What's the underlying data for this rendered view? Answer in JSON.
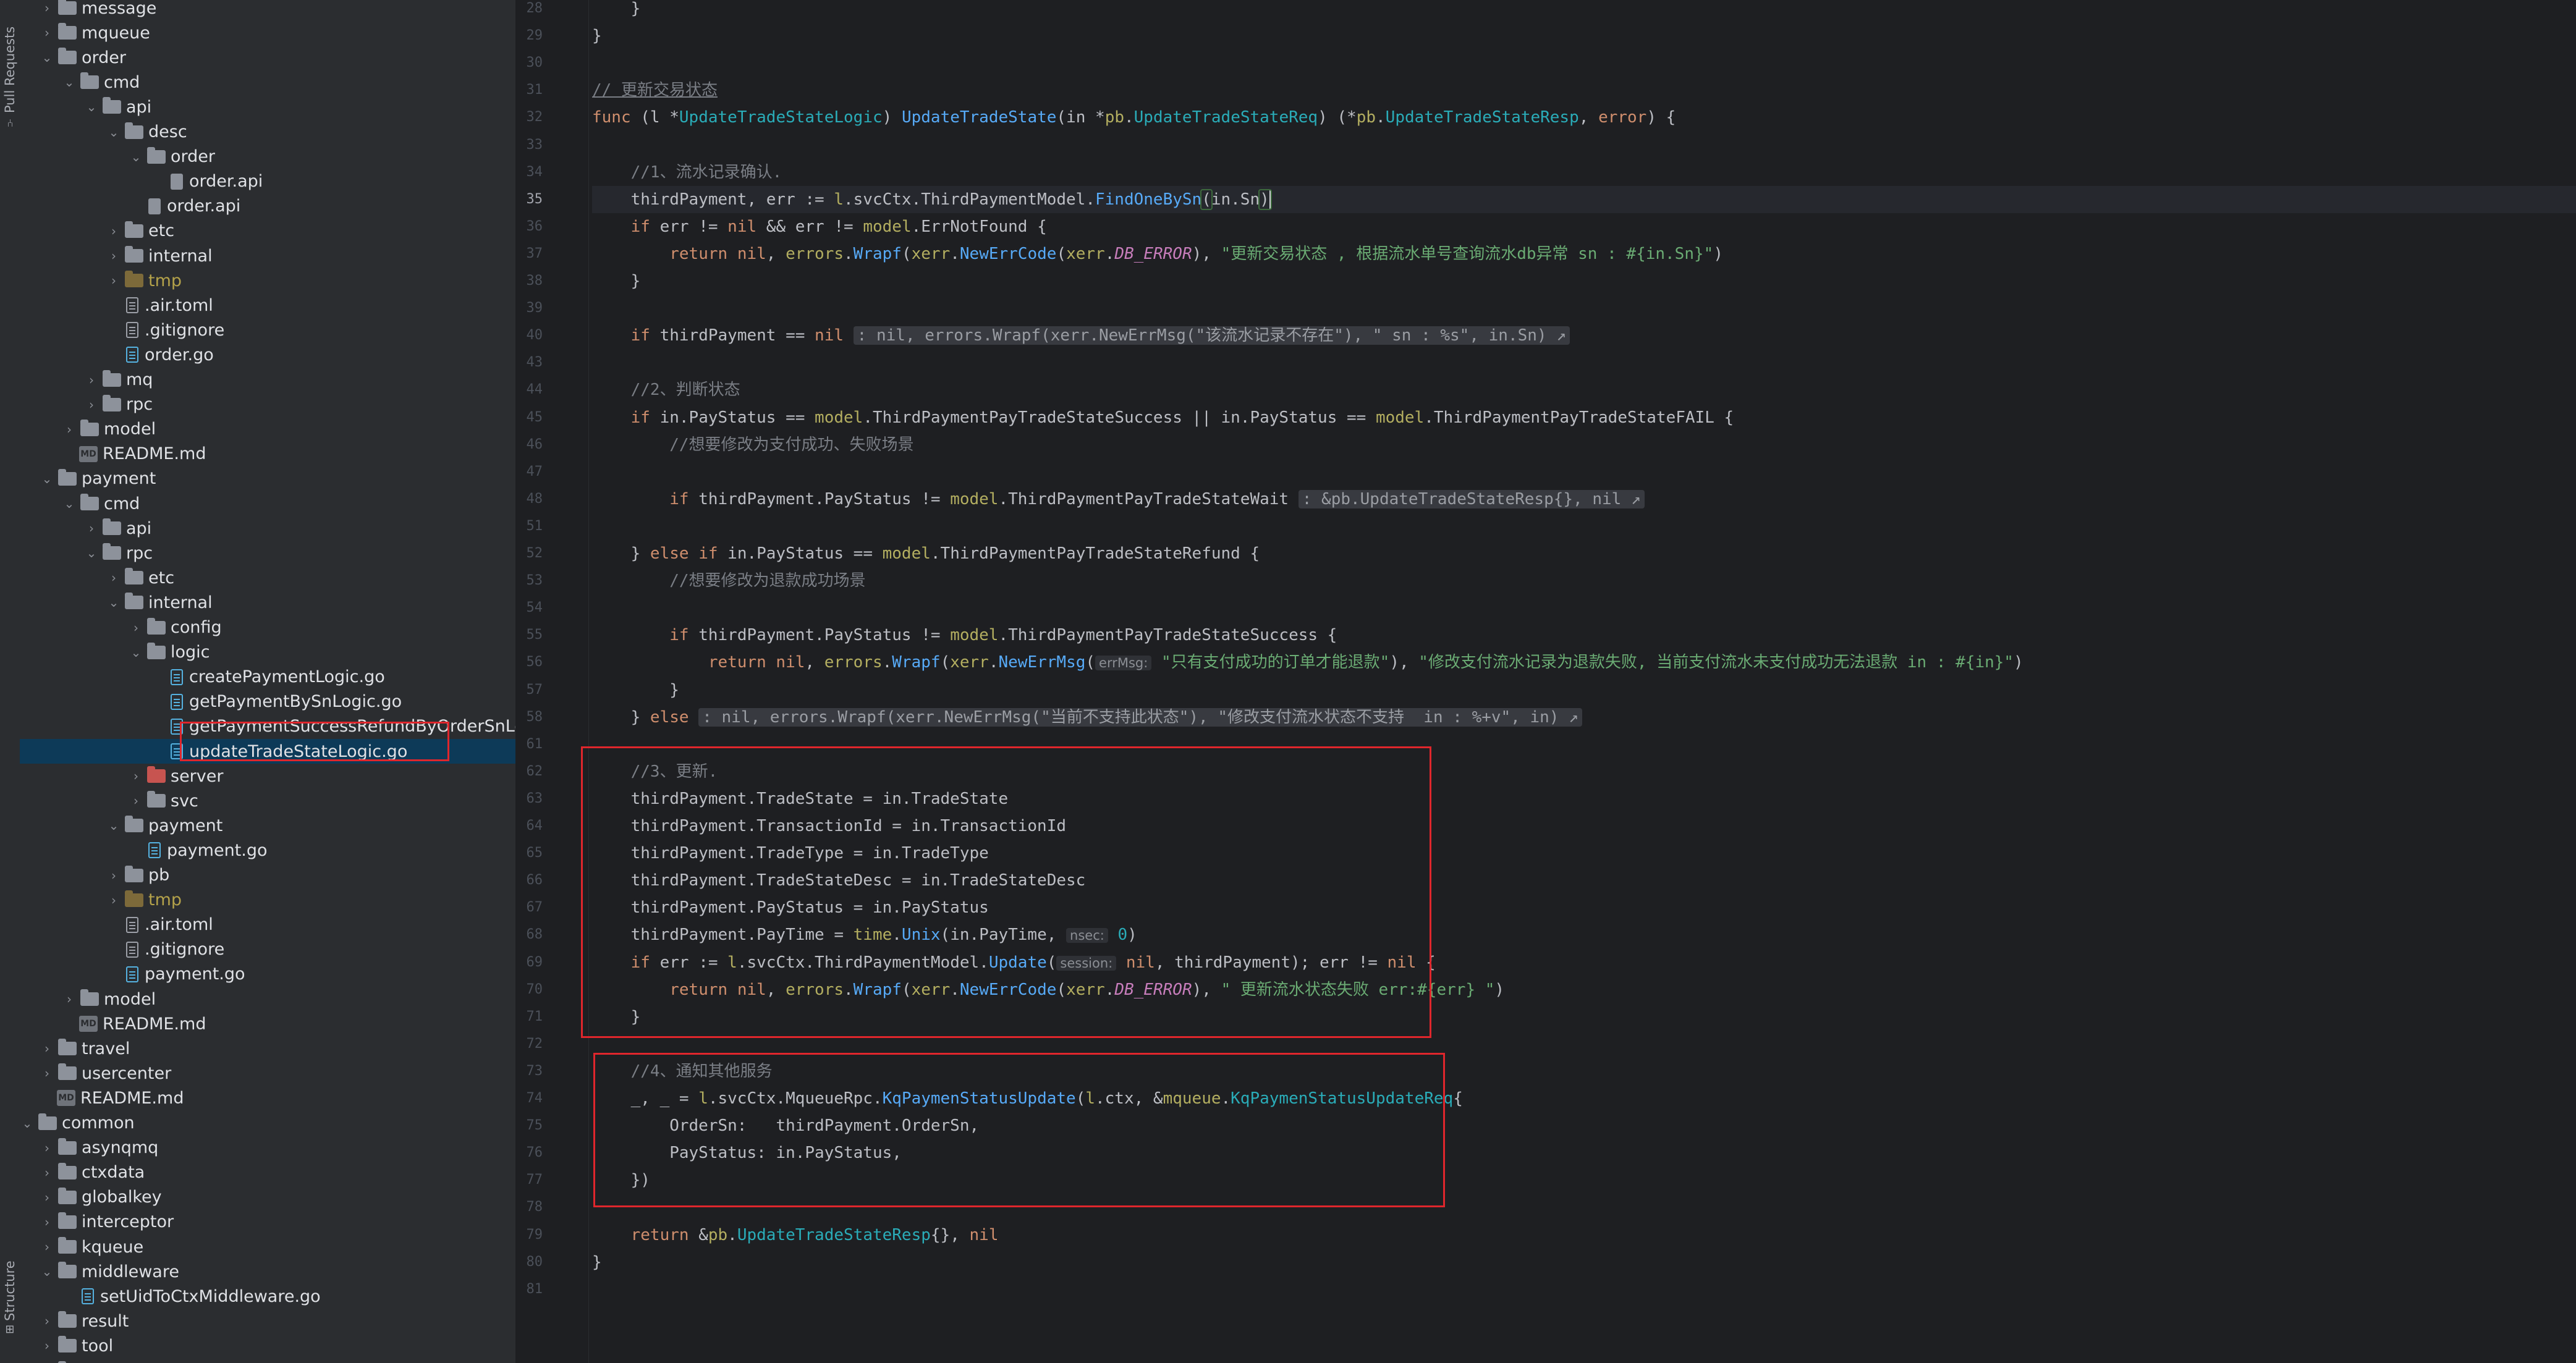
{
  "left_toolbar": {
    "pull_requests_label": "Pull Requests",
    "structure_label": "Structure"
  },
  "project_tree": {
    "items": [
      {
        "label": "message",
        "kind": "folder",
        "state": "collapsed"
      },
      {
        "label": "mqueue",
        "kind": "folder",
        "state": "collapsed"
      },
      {
        "label": "order",
        "kind": "folder",
        "state": "expanded"
      },
      {
        "label": "cmd",
        "kind": "folder",
        "state": "expanded"
      },
      {
        "label": "api",
        "kind": "folder",
        "state": "expanded"
      },
      {
        "label": "desc",
        "kind": "folder",
        "state": "expanded"
      },
      {
        "label": "order",
        "kind": "folder",
        "state": "expanded"
      },
      {
        "label": "order.api",
        "kind": "api-file"
      },
      {
        "label": "order.api",
        "kind": "api-file"
      },
      {
        "label": "etc",
        "kind": "folder",
        "state": "collapsed"
      },
      {
        "label": "internal",
        "kind": "folder",
        "state": "collapsed"
      },
      {
        "label": "tmp",
        "kind": "folder",
        "state": "collapsed",
        "excluded": true
      },
      {
        "label": ".air.toml",
        "kind": "text-file"
      },
      {
        "label": ".gitignore",
        "kind": "text-file"
      },
      {
        "label": "order.go",
        "kind": "go-file"
      },
      {
        "label": "mq",
        "kind": "folder",
        "state": "collapsed"
      },
      {
        "label": "rpc",
        "kind": "folder",
        "state": "collapsed"
      },
      {
        "label": "model",
        "kind": "folder",
        "state": "collapsed"
      },
      {
        "label": "README.md",
        "kind": "md-file"
      },
      {
        "label": "payment",
        "kind": "folder",
        "state": "expanded"
      },
      {
        "label": "cmd",
        "kind": "folder",
        "state": "expanded"
      },
      {
        "label": "api",
        "kind": "folder",
        "state": "collapsed"
      },
      {
        "label": "rpc",
        "kind": "folder",
        "state": "expanded"
      },
      {
        "label": "etc",
        "kind": "folder",
        "state": "collapsed"
      },
      {
        "label": "internal",
        "kind": "folder",
        "state": "expanded"
      },
      {
        "label": "config",
        "kind": "folder",
        "state": "collapsed"
      },
      {
        "label": "logic",
        "kind": "folder",
        "state": "expanded"
      },
      {
        "label": "createPaymentLogic.go",
        "kind": "go-file"
      },
      {
        "label": "getPaymentBySnLogic.go",
        "kind": "go-file"
      },
      {
        "label": "getPaymentSuccessRefundByOrderSnLogic.go",
        "kind": "go-file"
      },
      {
        "label": "updateTradeStateLogic.go",
        "kind": "go-file",
        "selected": true
      },
      {
        "label": "server",
        "kind": "folder",
        "state": "collapsed"
      },
      {
        "label": "svc",
        "kind": "folder",
        "state": "collapsed"
      },
      {
        "label": "payment",
        "kind": "folder",
        "state": "expanded"
      },
      {
        "label": "payment.go",
        "kind": "go-file"
      },
      {
        "label": "pb",
        "kind": "folder",
        "state": "collapsed"
      },
      {
        "label": "tmp",
        "kind": "folder",
        "state": "collapsed",
        "excluded": true
      },
      {
        "label": ".air.toml",
        "kind": "text-file"
      },
      {
        "label": ".gitignore",
        "kind": "text-file"
      },
      {
        "label": "payment.go",
        "kind": "go-file"
      },
      {
        "label": "model",
        "kind": "folder",
        "state": "collapsed"
      },
      {
        "label": "README.md",
        "kind": "md-file"
      },
      {
        "label": "travel",
        "kind": "folder",
        "state": "collapsed"
      },
      {
        "label": "usercenter",
        "kind": "folder",
        "state": "collapsed"
      },
      {
        "label": "README.md",
        "kind": "md-file"
      },
      {
        "label": "common",
        "kind": "folder",
        "state": "expanded"
      },
      {
        "label": "asynqmq",
        "kind": "folder",
        "state": "collapsed"
      },
      {
        "label": "ctxdata",
        "kind": "folder",
        "state": "collapsed"
      },
      {
        "label": "globalkey",
        "kind": "folder",
        "state": "collapsed"
      },
      {
        "label": "interceptor",
        "kind": "folder",
        "state": "collapsed"
      },
      {
        "label": "kqueue",
        "kind": "folder",
        "state": "collapsed"
      },
      {
        "label": "middleware",
        "kind": "folder",
        "state": "expanded"
      },
      {
        "label": "setUidToCtxMiddleware.go",
        "kind": "go-file"
      },
      {
        "label": "result",
        "kind": "folder",
        "state": "collapsed"
      },
      {
        "label": "tool",
        "kind": "folder",
        "state": "collapsed"
      },
      {
        "label": "uniqueid",
        "kind": "folder",
        "state": "collapsed"
      }
    ]
  },
  "editor": {
    "current_line": 35,
    "line_numbers": [
      "28",
      "29",
      "30",
      "31",
      "32",
      "33",
      "34",
      "35",
      "36",
      "37",
      "38",
      "39",
      "40",
      "43",
      "44",
      "45",
      "46",
      "47",
      "48",
      "51",
      "52",
      "53",
      "54",
      "55",
      "56",
      "57",
      "58",
      "61",
      "62",
      "63",
      "64",
      "65",
      "66",
      "67",
      "68",
      "69",
      "70",
      "71",
      "72",
      "73",
      "74",
      "75",
      "76",
      "77",
      "78",
      "79",
      "80",
      "81"
    ],
    "lines": [
      "    }",
      "}",
      "",
      "// 更新交易状态",
      "func (l *UpdateTradeStateLogic) UpdateTradeState(in *pb.UpdateTradeStateReq) (*pb.UpdateTradeStateResp, error) {",
      "",
      "    //1、流水记录确认.",
      "    thirdPayment, err := l.svcCtx.ThirdPaymentModel.FindOneBySn(in.Sn)",
      "    if err != nil && err != model.ErrNotFound {",
      "        return nil, errors.Wrapf(xerr.NewErrCode(xerr.DB_ERROR), \"更新交易状态 , 根据流水单号查询流水db异常 sn : #{in.Sn}\")",
      "    }",
      "",
      "    if thirdPayment == nil : nil, errors.Wrapf(xerr.NewErrMsg(\"该流水记录不存在\"), \" sn : %s\", in.Sn) ↗",
      "",
      "    //2、判断状态",
      "    if in.PayStatus == model.ThirdPaymentPayTradeStateSuccess || in.PayStatus == model.ThirdPaymentPayTradeStateFAIL {",
      "        //想要修改为支付成功、失败场景",
      "",
      "        if thirdPayment.PayStatus != model.ThirdPaymentPayTradeStateWait : &pb.UpdateTradeStateResp{}, nil ↗",
      "",
      "    } else if in.PayStatus == model.ThirdPaymentPayTradeStateRefund {",
      "        //想要修改为退款成功场景",
      "",
      "        if thirdPayment.PayStatus != model.ThirdPaymentPayTradeStateSuccess {",
      "            return nil, errors.Wrapf(xerr.NewErrMsg( errMsg: \"只有支付成功的订单才能退款\"), \"修改支付流水记录为退款失败, 当前支付流水未支付成功无法退款 in : #{in}\")",
      "        }",
      "    } else : nil, errors.Wrapf(xerr.NewErrMsg(\"当前不支持此状态\"), \"修改支付流水状态不支持  in : %+v\", in) ↗",
      "",
      "    //3、更新.",
      "    thirdPayment.TradeState = in.TradeState",
      "    thirdPayment.TransactionId = in.TransactionId",
      "    thirdPayment.TradeType = in.TradeType",
      "    thirdPayment.TradeStateDesc = in.TradeStateDesc",
      "    thirdPayment.PayStatus = in.PayStatus",
      "    thirdPayment.PayTime = time.Unix(in.PayTime,  nsec: 0)",
      "    if err := l.svcCtx.ThirdPaymentModel.Update( session: nil, thirdPayment); err != nil {",
      "        return nil, errors.Wrapf(xerr.NewErrCode(xerr.DB_ERROR), \" 更新流水状态失败 err:#{err} \")",
      "    }",
      "",
      "    //4、通知其他服务",
      "    _, _ = l.svcCtx.MqueueRpc.KqPaymenStatusUpdate(l.ctx, &mqueue.KqPaymenStatusUpdateReq{",
      "        OrderSn:   thirdPayment.OrderSn,",
      "        PayStatus: in.PayStatus,",
      "    })",
      "",
      "    return &pb.UpdateTradeStateResp{}, nil",
      "}",
      ""
    ]
  },
  "colors": {
    "keyword": "#cf8e6d",
    "function": "#57aaf7",
    "type": "#2aacb8",
    "string": "#6aab73",
    "comment": "#7a7e85",
    "highlight_box": "#e0262c",
    "selection": "#0d3a58"
  }
}
